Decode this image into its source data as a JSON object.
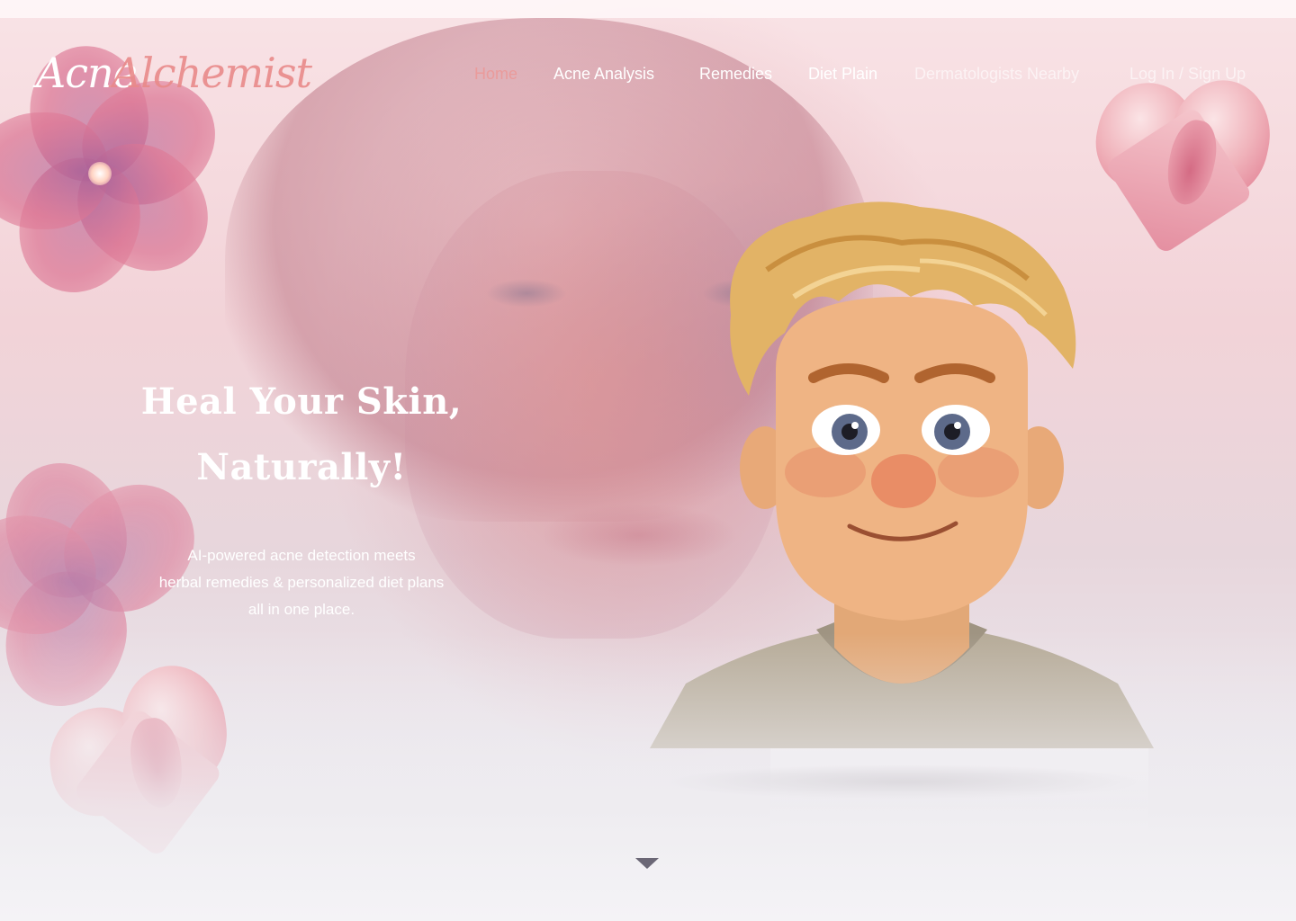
{
  "logo": {
    "part1": "Acne",
    "part2": "Alchemist"
  },
  "nav": {
    "items": [
      {
        "label": "Home",
        "active": true
      },
      {
        "label": "Acne Analysis"
      },
      {
        "label": "Remedies"
      },
      {
        "label": "Diet Plain"
      },
      {
        "label": "Dermatologists Nearby"
      }
    ],
    "auth_label": "Log In / Sign Up"
  },
  "hero": {
    "headline_line1": "Heal Your Skin,",
    "headline_line2": "Naturally!",
    "subtext_line1": "AI-powered acne detection meets",
    "subtext_line2": "herbal remedies & personalized diet plans",
    "subtext_line3": "all in one place."
  },
  "colors": {
    "accent": "#ea9b9b",
    "text": "#ffffff",
    "arrow": "#6b6776"
  },
  "icons": {
    "scroll": "chevron-down-icon"
  }
}
